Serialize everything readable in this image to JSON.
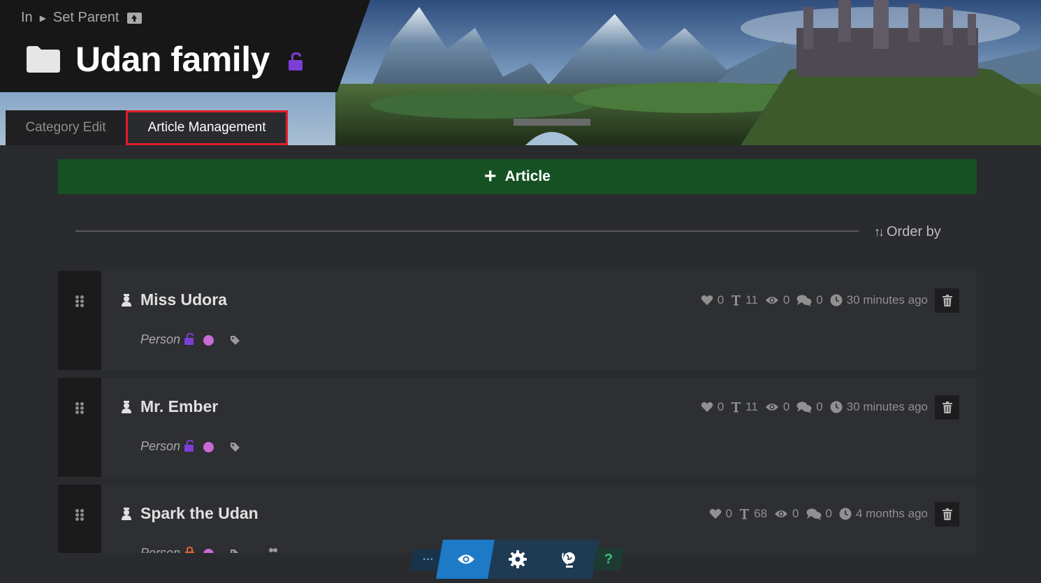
{
  "breadcrumb": {
    "in_label": "In",
    "parent_label": "Set Parent"
  },
  "page": {
    "title": "Udan family"
  },
  "tabs": [
    {
      "label": "Category Edit",
      "active": false
    },
    {
      "label": "Article Management",
      "active": true
    }
  ],
  "add_button": {
    "label": "Article"
  },
  "order_by": {
    "label": "Order by"
  },
  "articles": [
    {
      "title": "Miss Udora",
      "type": "Person",
      "likes": "0",
      "words": "11",
      "views": "0",
      "comments": "0",
      "updated": "30 minutes ago",
      "lock_color": "#7b3fd6"
    },
    {
      "title": "Mr. Ember",
      "type": "Person",
      "likes": "0",
      "words": "11",
      "views": "0",
      "comments": "0",
      "updated": "30 minutes ago",
      "lock_color": "#7b3fd6"
    },
    {
      "title": "Spark the Udan",
      "type": "Person",
      "likes": "0",
      "words": "68",
      "views": "0",
      "comments": "0",
      "updated": "4 months ago",
      "lock_color": "#e0662a"
    }
  ],
  "toolbar": {
    "more_label": "···",
    "help_label": "?"
  },
  "colors": {
    "accent_green": "#155123",
    "tab_highlight": "#e21c2b",
    "lock_purple": "#7b3fd6",
    "dot_pink": "#c86bd4",
    "toolbar_blue": "#1d7ac6"
  }
}
